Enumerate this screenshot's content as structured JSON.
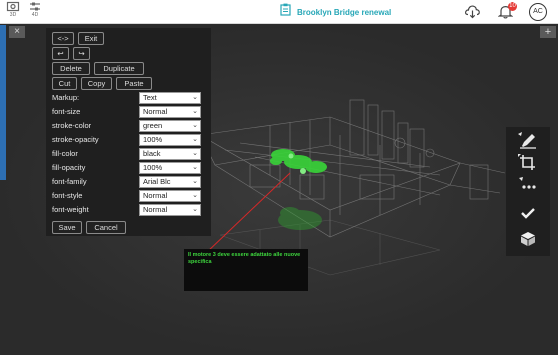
{
  "toolbar": {
    "tool3d_label": "3D",
    "tool4d_label": "4D",
    "project_name": "Brooklyn Bridge renewal",
    "notification_count": "10",
    "avatar_initials": "AC"
  },
  "markup_panel": {
    "nav_label": "<->",
    "exit_label": "Exit",
    "undo_label": "↩",
    "redo_label": "↪",
    "delete_label": "Delete",
    "duplicate_label": "Duplicate",
    "cut_label": "Cut",
    "copy_label": "Copy",
    "paste_label": "Paste",
    "properties": [
      {
        "label": "Markup:",
        "value": "Text"
      },
      {
        "label": "font-size",
        "value": "Normal"
      },
      {
        "label": "stroke-color",
        "value": "green"
      },
      {
        "label": "stroke-opacity",
        "value": "100%"
      },
      {
        "label": "fill-color",
        "value": "black"
      },
      {
        "label": "fill-opacity",
        "value": "100%"
      },
      {
        "label": "font-family",
        "value": "Arial Blc"
      },
      {
        "label": "font-style",
        "value": "Normal"
      },
      {
        "label": "font-weight",
        "value": "Normal"
      }
    ],
    "save_label": "Save",
    "cancel_label": "Cancel"
  },
  "annotation": {
    "text": "Il motore 3 deve essere adattato alle nuove specifica"
  },
  "viewer": {
    "close_label": "×",
    "add_label": "+"
  },
  "colors": {
    "accent": "#27a7b7",
    "highlight": "#3ed63e",
    "badge": "#e53935"
  },
  "icons": [
    "3d-view-icon",
    "4d-view-icon",
    "clipboard-icon",
    "cloud-download-icon",
    "bell-icon",
    "avatar",
    "pencil-icon",
    "crop-icon",
    "more-icon",
    "check-icon",
    "cube-icon"
  ]
}
